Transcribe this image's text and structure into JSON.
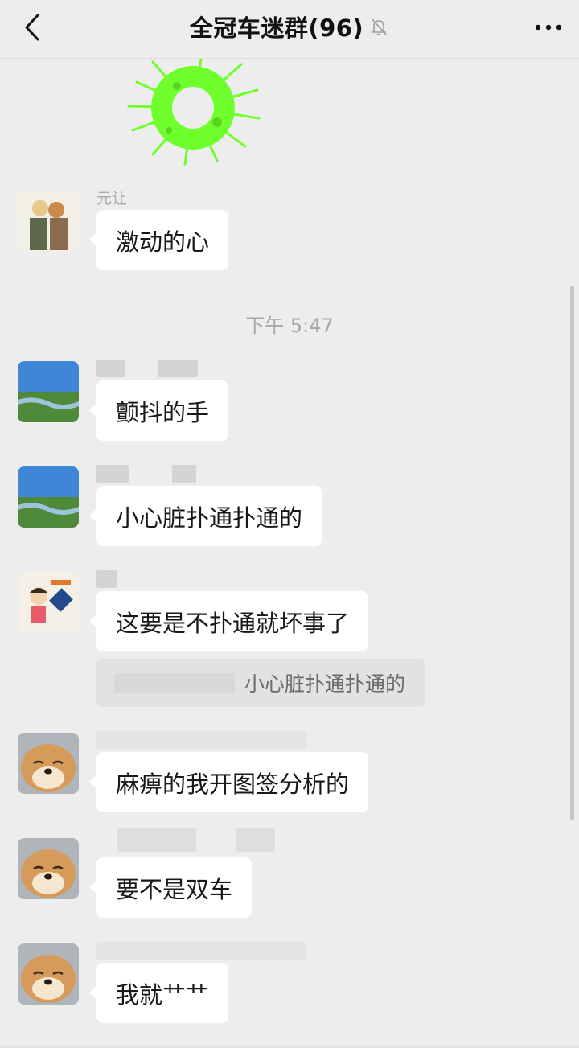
{
  "header": {
    "title": "全冠车迷群(96)",
    "back_icon": "chevron-left-icon",
    "mute_icon": "bell-off-icon",
    "more_icon": "more-dots-icon"
  },
  "time_divider": "下午 5:47",
  "messages": [
    {
      "sender": "元让",
      "text": "激动的心",
      "avatar": "anime-couple-avatar"
    },
    {
      "sender": "",
      "text": "颤抖的手",
      "avatar": "landscape-avatar"
    },
    {
      "sender": "",
      "text": "小心脏扑通扑通的",
      "avatar": "landscape-avatar"
    },
    {
      "sender": "",
      "text": "这要是不扑通就坏事了",
      "avatar": "cartoon-boy-avatar",
      "quote": {
        "text": "小心脏扑通扑通的"
      }
    },
    {
      "sender": "",
      "text": "麻痹的我开图签分析的",
      "avatar": "shiba-dog-avatar"
    },
    {
      "sender": "",
      "text": "要不是双车",
      "avatar": "shiba-dog-avatar"
    },
    {
      "sender": "",
      "text": "我就艹艹",
      "avatar": "shiba-dog-avatar"
    }
  ],
  "colors": {
    "background": "#ededed",
    "bubble": "#ffffff",
    "sticker_green": "#6fff2c"
  }
}
